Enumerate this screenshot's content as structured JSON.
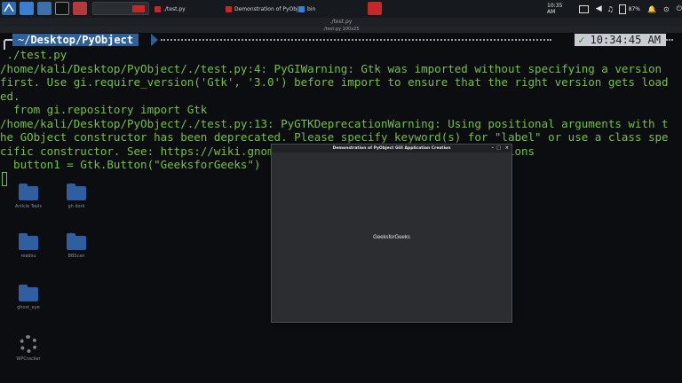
{
  "taskbar": {
    "tasks": [
      {
        "label": "./test.py",
        "icon": "terminal-icon"
      },
      {
        "label": "Demonstration of PyObj...",
        "icon": "app-window-icon"
      },
      {
        "label": "bin",
        "icon": "folder-icon"
      }
    ],
    "clock": "10:35 AM",
    "battery": "87%",
    "accent_colors": {
      "red": "#d32f2f",
      "blue": "#2f6db3"
    }
  },
  "desktop_icons": [
    {
      "label": "Article Tools",
      "icon": "folder-icon"
    },
    {
      "label": "gh dork",
      "icon": "folder-icon"
    },
    {
      "label": "readsu",
      "icon": "folder-locked-icon"
    },
    {
      "label": "BBScan",
      "icon": "folder-icon"
    },
    {
      "label": "ghost_eye",
      "icon": "folder-locked-icon"
    },
    {
      "label": "WPCracker",
      "icon": "gear-icon"
    }
  ],
  "terminal": {
    "window_title": "./test.py",
    "tab_title": "./test.py 100x25",
    "prompt_prefix": "~/",
    "prompt_path": "Desktop/PyObject",
    "prompt_time": "10:34:45 AM",
    "command": " ./test.py",
    "output_lines": [
      "/home/kali/Desktop/PyObject/./test.py:4: PyGIWarning: Gtk was imported without specifying a version",
      "first. Use gi.require_version('Gtk', '3.0') before import to ensure that the right version gets load",
      "ed.",
      "  from gi.repository import Gtk",
      "/home/kali/Desktop/PyObject/./test.py:13: PyGTKDeprecationWarning: Using positional arguments with t",
      "he GObject constructor has been deprecated. Please specify keyword(s) for \"label\" or use a class spe",
      "cific constructor. See: https://wiki.gnome.org/PyGObject/InitializerDeprecations",
      "  button1 = Gtk.Button(\"GeeksforGeeks\")"
    ]
  },
  "gtk_window": {
    "title": "Demonstration of PyObject GUI Application Creation",
    "minimize": "–",
    "maximize": "□",
    "close": "×",
    "button_label": "GeeksforGeeks"
  }
}
